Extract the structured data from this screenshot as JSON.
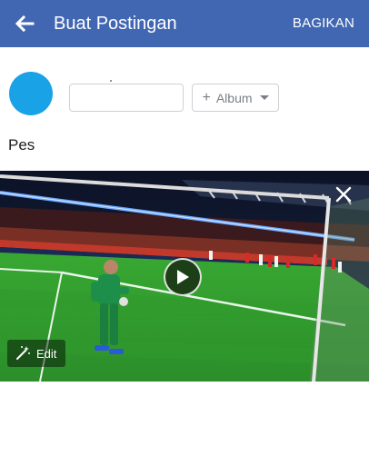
{
  "header": {
    "title": "Buat Postingan",
    "share_label": "BAGIKAN",
    "back_icon": "arrow-left-icon"
  },
  "composer": {
    "privacy_value": "",
    "album_label": "Album",
    "album_prefix": "+",
    "post_text": "Pes"
  },
  "media": {
    "edit_label": "Edit",
    "close_icon": "close-icon",
    "play_icon": "play-icon",
    "edit_icon": "magic-wand-icon"
  },
  "colors": {
    "brand": "#4267b2",
    "avatar": "#1aa2e6",
    "pitch": "#2f9e2a"
  }
}
